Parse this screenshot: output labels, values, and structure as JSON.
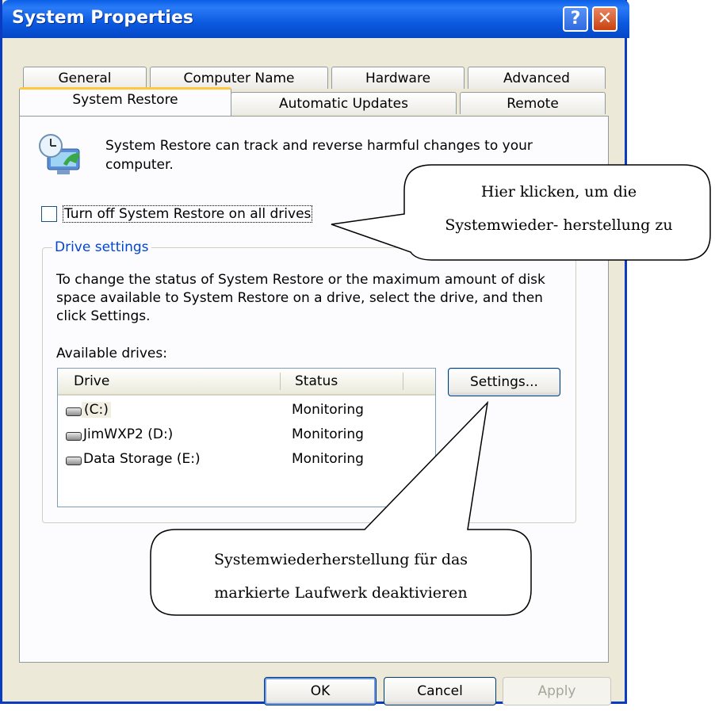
{
  "window": {
    "title": "System Properties",
    "help_glyph": "?",
    "close_glyph": "✕"
  },
  "tabs": {
    "row1": [
      "General",
      "Computer Name",
      "Hardware",
      "Advanced"
    ],
    "row2": [
      "System Restore",
      "Automatic Updates",
      "Remote"
    ],
    "active": "System Restore"
  },
  "intro": {
    "icon": "system-restore-icon",
    "text": "System Restore can track and reverse harmful changes to your computer."
  },
  "checkbox": {
    "label": "Turn off System Restore on all drives",
    "checked": false
  },
  "drive_settings": {
    "title": "Drive settings",
    "description": "To change the status of System Restore or the maximum amount of disk space available to System Restore on a drive, select the drive, and then click Settings.",
    "available_label": "Available drives:",
    "columns": [
      "Drive",
      "Status"
    ],
    "drives": [
      {
        "name": "(C:)",
        "status": "Monitoring",
        "icon": "hard-drive-icon"
      },
      {
        "name": "JimWXP2 (D:)",
        "status": "Monitoring",
        "icon": "hard-drive-icon"
      },
      {
        "name": "Data Storage (E:)",
        "status": "Monitoring",
        "icon": "hard-drive-icon"
      }
    ],
    "settings_button": "Settings..."
  },
  "buttons": {
    "ok": "OK",
    "cancel": "Cancel",
    "apply": "Apply"
  },
  "callouts": {
    "top_line1": "Hier klicken, um die",
    "top_line2": "Systemwieder- herstellung zu",
    "bottom_line1": "Systemwiederherstellung für das",
    "bottom_line2": "markierte Laufwerk deaktivieren"
  },
  "colors": {
    "titlebar": "#0a5fe6",
    "active_tab_accent": "#ffc73c",
    "group_title": "#0046d5"
  }
}
